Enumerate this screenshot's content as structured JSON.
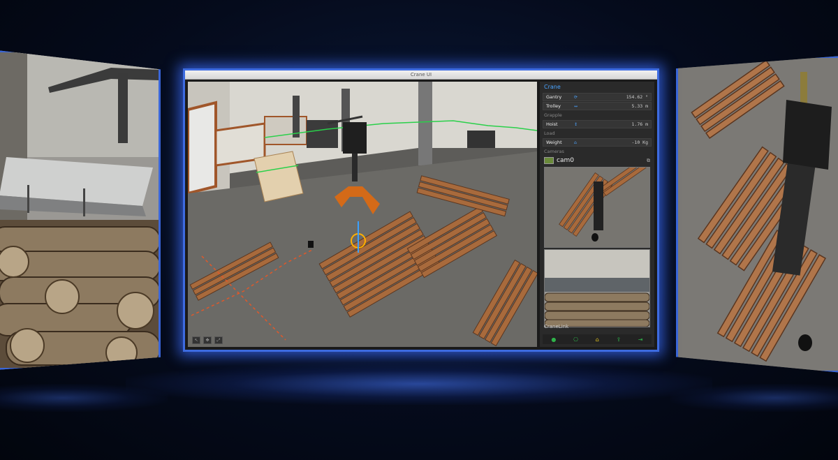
{
  "window": {
    "title": "Crane UI"
  },
  "panel": {
    "crane_title": "Crane",
    "gantry": {
      "label": "Gantry",
      "icon": "rotate-icon",
      "value": "154.62 °"
    },
    "trolley": {
      "label": "Trolley",
      "icon": "arrows-horizontal-icon",
      "value": "5.33 m"
    },
    "grapple_title": "Grapple",
    "hoist": {
      "label": "Hoist",
      "icon": "arrows-vertical-icon",
      "value": "1.76 m"
    },
    "load_title": "Load",
    "weight": {
      "label": "Weight",
      "icon": "weight-icon",
      "value": "-10 Kg"
    },
    "cameras_title": "Cameras",
    "camera_name": "cam0",
    "cranelink_title": "CraneLink"
  },
  "colors": {
    "accent": "#4aa3ff",
    "frame_glow": "#3d6be0",
    "link_ok": "#2fb34a",
    "link_highlight": "#e0c020"
  }
}
